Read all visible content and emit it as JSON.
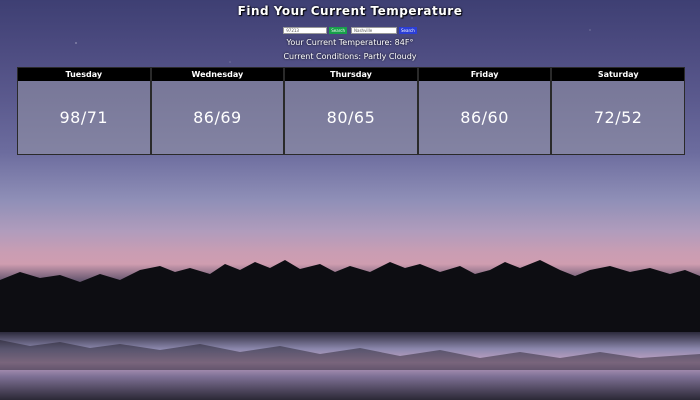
{
  "page": {
    "title": "Find Your Current Temperature"
  },
  "search": {
    "zip_value": "97213",
    "zip_button": "Search",
    "city_value": "Nashville",
    "city_button": "Search"
  },
  "current": {
    "temperature_text": "Your Current Temperature: 84F°",
    "conditions_text": "Current Conditions: Partly Cloudy"
  },
  "forecast": [
    {
      "day": "Tuesday",
      "temps": "98/71"
    },
    {
      "day": "Wednesday",
      "temps": "86/69"
    },
    {
      "day": "Thursday",
      "temps": "80/65"
    },
    {
      "day": "Friday",
      "temps": "86/60"
    },
    {
      "day": "Saturday",
      "temps": "72/52"
    }
  ],
  "colors": {
    "zip_button": "#18a04a",
    "city_button": "#2b3ed6",
    "forecast_header": "#000000"
  }
}
